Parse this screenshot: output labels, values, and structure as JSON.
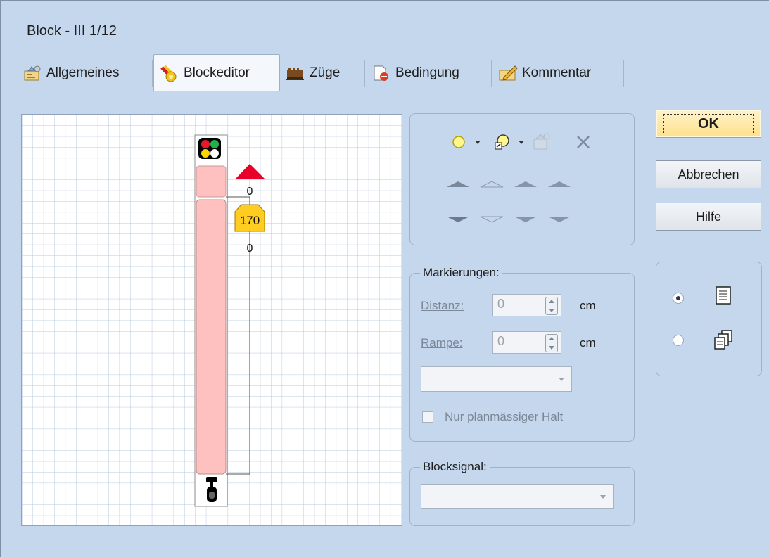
{
  "window": {
    "title": "Block - III 1/12"
  },
  "tabs": [
    {
      "label": "Allgemeines",
      "icon": "settings-card-icon",
      "active": false
    },
    {
      "label": "Blockeditor",
      "icon": "block-editor-icon",
      "active": true
    },
    {
      "label": "Züge",
      "icon": "train-icon",
      "active": false
    },
    {
      "label": "Bedingung",
      "icon": "condition-icon",
      "active": false
    },
    {
      "label": "Kommentar",
      "icon": "comment-icon",
      "active": false
    }
  ],
  "editor": {
    "distance_top": "0",
    "speed_limit": "170",
    "distance_bottom": "0",
    "colors": {
      "block_fill": "#ffc0c0",
      "marker_red": "#e8002a",
      "speed_sign": "#ffcc22"
    }
  },
  "toolbar": {
    "icons": [
      "add-contact-icon",
      "dropdown-icon",
      "add-function-icon",
      "dropdown-icon",
      "properties-icon",
      "delete-icon"
    ],
    "row_up": [
      "move-up-filled-icon",
      "move-up-outline-icon",
      "move-up-filled-icon",
      "move-up-filled-icon"
    ],
    "row_down": [
      "move-down-filled-icon",
      "move-down-outline-icon",
      "move-down-filled-icon",
      "move-down-filled-icon"
    ]
  },
  "markings": {
    "title": "Markierungen:",
    "distance_label": "Distanz:",
    "distance_value": "0",
    "distance_unit": "cm",
    "ramp_label": "Rampe:",
    "ramp_value": "0",
    "ramp_unit": "cm",
    "combo_value": "",
    "only_scheduled_stop_label": "Nur planmässiger Halt",
    "only_scheduled_stop_checked": false
  },
  "block_signal": {
    "title": "Blocksignal:",
    "value": ""
  },
  "buttons": {
    "ok": "OK",
    "cancel": "Abbrechen",
    "help": "Hilfe"
  },
  "view_mode": {
    "options": [
      "list-view-icon",
      "multi-window-icon"
    ],
    "selected_index": 0
  }
}
